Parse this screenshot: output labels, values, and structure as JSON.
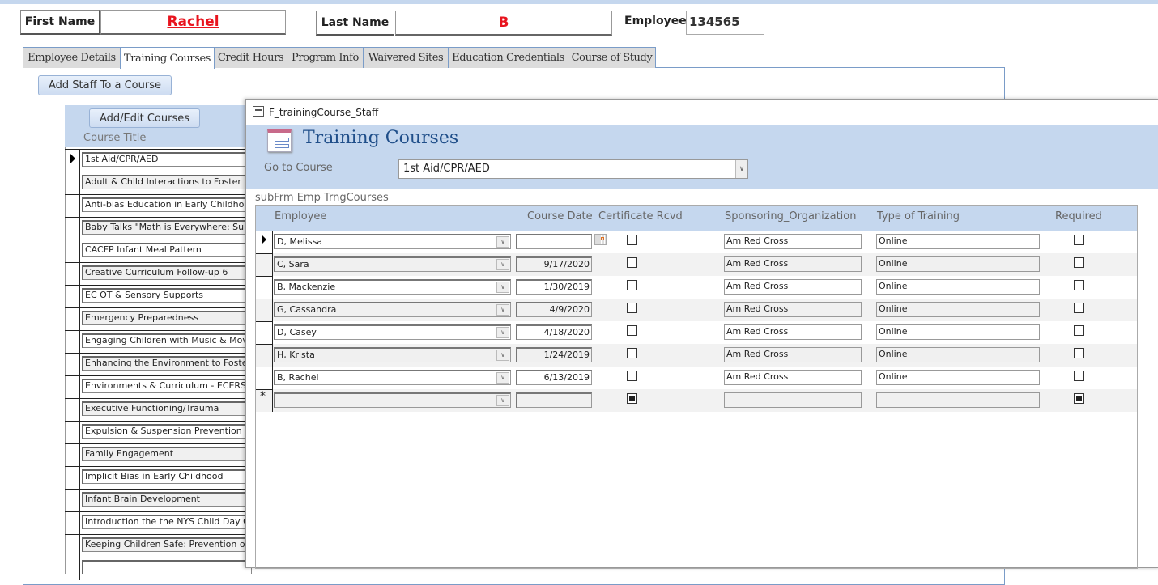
{
  "header": {
    "first_name_label": "First Name",
    "first_name": "Rachel",
    "last_name_label": "Last Name",
    "last_name": "B",
    "employee_label": "Employee",
    "employee_id": "134565"
  },
  "tabs": [
    "Employee Details",
    "Training Courses",
    "Credit Hours",
    "Program Info",
    "Waivered Sites",
    "Education Credentials",
    "Course of Study"
  ],
  "active_tab": "Training Courses",
  "add_staff_button": "Add Staff To a Course",
  "courses_panel": {
    "add_edit_button": "Add/Edit Courses",
    "column_header": "Course Title",
    "courses": [
      "1st Aid/CPR/AED",
      "Adult & Child Interactions to Foster Executive Function",
      "Anti-bias Education in Early Childhood",
      "Baby Talks \"Math is Everywhere: Supporting",
      "CACFP Infant Meal Pattern",
      "Creative Curriculum Follow-up 6",
      "EC OT & Sensory Supports",
      "Emergency Preparedness",
      "Engaging Children with Music & Movement",
      "Enhancing the Environment to Foster",
      "Environments & Curriculum - ECERS",
      "Executive Functioning/Trauma",
      "Expulsion & Suspension Prevention S",
      "Family Engagement",
      "Implicit Bias in Early Childhood",
      "Infant Brain Development",
      "Introduction the the NYS Child Day Care",
      "Keeping Children Safe: Prevention of",
      ""
    ]
  },
  "popup": {
    "window_title": "F_trainingCourse_Staff",
    "form_title": "Training Courses",
    "go_to_label": "Go to Course",
    "go_to_value": "1st Aid/CPR/AED",
    "subform_label": "subFrm  Emp  TrngCourses",
    "columns": [
      "Employee",
      "Course Date",
      "Certificate Rcvd",
      "Sponsoring_Organization",
      "Type of Training",
      "Required"
    ],
    "rows": [
      {
        "employee": "D, Melissa",
        "date": "",
        "cert": false,
        "sponsor": "Am Red Cross",
        "type": "Online",
        "required": false
      },
      {
        "employee": "C, Sara",
        "date": "9/17/2020",
        "cert": false,
        "sponsor": "Am Red Cross",
        "type": "Online",
        "required": false
      },
      {
        "employee": "B, Mackenzie",
        "date": "1/30/2019",
        "cert": false,
        "sponsor": "Am Red Cross",
        "type": "Online",
        "required": false
      },
      {
        "employee": "G, Cassandra",
        "date": "4/9/2020",
        "cert": false,
        "sponsor": "Am Red Cross",
        "type": "Online",
        "required": false
      },
      {
        "employee": "D, Casey",
        "date": "4/18/2020",
        "cert": false,
        "sponsor": "Am Red Cross",
        "type": "Online",
        "required": false
      },
      {
        "employee": "H, Krista",
        "date": "1/24/2019",
        "cert": false,
        "sponsor": "Am Red Cross",
        "type": "Online",
        "required": false
      },
      {
        "employee": "B, Rachel",
        "date": "6/13/2019",
        "cert": false,
        "sponsor": "Am Red Cross",
        "type": "Online",
        "required": false
      }
    ],
    "new_row_marker": "*"
  },
  "colors": {
    "accent_blue": "#c5d7ee",
    "name_red": "#e8141e",
    "title_blue": "#1f4e89"
  }
}
